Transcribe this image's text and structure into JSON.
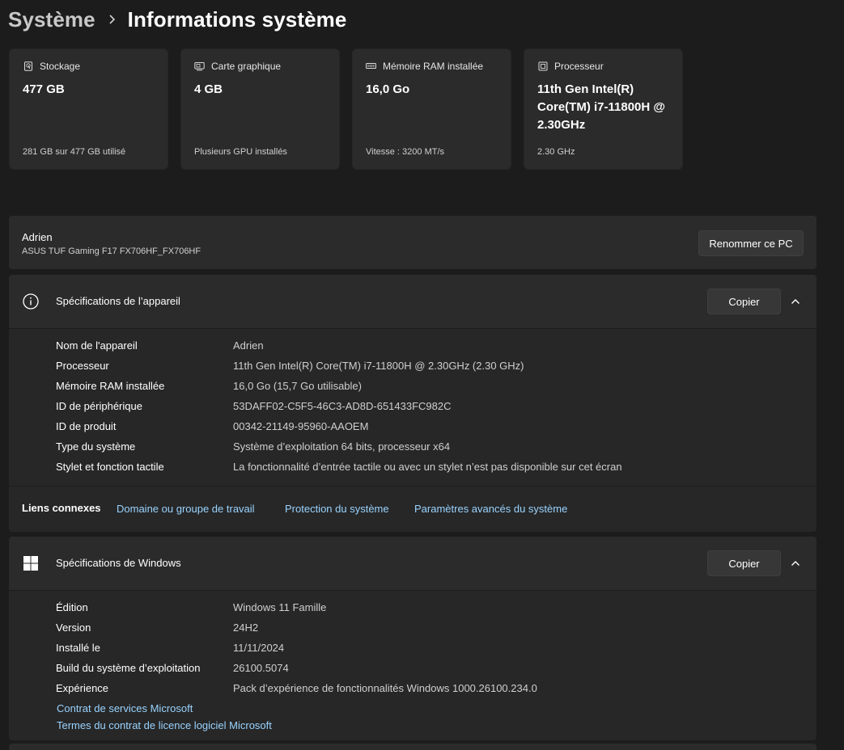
{
  "breadcrumb": {
    "parent": "Système",
    "separator": "›",
    "current": "Informations système"
  },
  "cards": [
    {
      "icon": "storage-icon",
      "label": "Stockage",
      "value": "477 GB",
      "sub": "281 GB sur 477 GB utilisé"
    },
    {
      "icon": "graphics-card-icon",
      "label": "Carte graphique",
      "value": "4 GB",
      "sub": "Plusieurs GPU installés"
    },
    {
      "icon": "ram-icon",
      "label": "Mémoire RAM installée",
      "value": "16,0 Go",
      "sub": "Vitesse : 3200 MT/s"
    },
    {
      "icon": "processor-icon",
      "label": "Processeur",
      "value_lines": [
        "11th Gen Intel(R)",
        "Core(TM) i7-11800H @",
        "2.30GHz"
      ],
      "sub": "2.30 GHz"
    }
  ],
  "device": {
    "name": "Adrien",
    "model": "ASUS TUF Gaming F17 FX706HF_FX706HF",
    "rename_label": "Renommer ce PC"
  },
  "device_specs": {
    "title": "Spécifications de l’appareil",
    "copy_label": "Copier",
    "rows": [
      {
        "label": "Nom de l'appareil",
        "value": "Adrien"
      },
      {
        "label": "Processeur",
        "value": "11th Gen Intel(R) Core(TM) i7-11800H @ 2.30GHz (2.30 GHz)"
      },
      {
        "label": "Mémoire RAM installée",
        "value": "16,0 Go (15,7 Go utilisable)"
      },
      {
        "label": "ID de périphérique",
        "value": "53DAFF02-C5F5-46C3-AD8D-651433FC982C"
      },
      {
        "label": "ID de produit",
        "value": "00342-21149-95960-AAOEM"
      },
      {
        "label": "Type du système",
        "value": "Système d’exploitation 64 bits, processeur x64"
      },
      {
        "label": "Stylet et fonction tactile",
        "value": "La fonctionnalité d’entrée tactile ou avec un stylet n’est pas disponible sur cet écran"
      }
    ]
  },
  "related_links": {
    "label": "Liens connexes",
    "links": [
      "Domaine ou groupe de travail",
      "Protection du système",
      "Paramètres avancés du système"
    ]
  },
  "windows_specs": {
    "title": "Spécifications de Windows",
    "copy_label": "Copier",
    "rows": [
      {
        "label": "Édition",
        "value": "Windows 11 Famille"
      },
      {
        "label": "Version",
        "value": "24H2"
      },
      {
        "label": "Installé le",
        "value": "11/11/2024"
      },
      {
        "label": "Build du système d’exploitation",
        "value": "26100.5074"
      },
      {
        "label": "Expérience",
        "value": "Pack d’expérience de fonctionnalités Windows 1000.26100.234.0"
      }
    ],
    "links": [
      "Contrat de services Microsoft",
      "Termes du contrat de licence logiciel Microsoft"
    ]
  },
  "colors": {
    "background": "#1c1c1c",
    "card": "#2b2b2b",
    "link": "#99d3ff"
  }
}
